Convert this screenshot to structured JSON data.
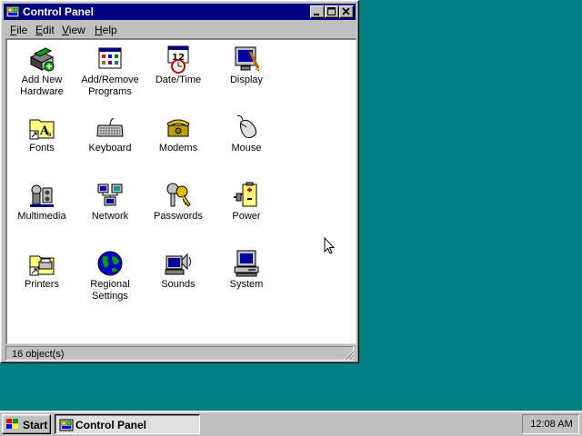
{
  "window": {
    "title": "Control Panel",
    "title_icon": "control-panel-icon",
    "controls": [
      "minimize",
      "maximize",
      "close"
    ]
  },
  "menu": [
    "File",
    "Edit",
    "View",
    "Help"
  ],
  "items": [
    {
      "label": "Add New\nHardware",
      "icon": "add-hardware-icon"
    },
    {
      "label": "Add/Remove\nPrograms",
      "icon": "add-remove-programs-icon"
    },
    {
      "label": "Date/Time",
      "icon": "date-time-icon"
    },
    {
      "label": "Display",
      "icon": "display-icon"
    },
    {
      "label": "Fonts",
      "icon": "fonts-icon"
    },
    {
      "label": "Keyboard",
      "icon": "keyboard-icon"
    },
    {
      "label": "Modems",
      "icon": "modems-icon"
    },
    {
      "label": "Mouse",
      "icon": "mouse-icon"
    },
    {
      "label": "Multimedia",
      "icon": "multimedia-icon"
    },
    {
      "label": "Network",
      "icon": "network-icon"
    },
    {
      "label": "Passwords",
      "icon": "passwords-icon"
    },
    {
      "label": "Power",
      "icon": "power-icon"
    },
    {
      "label": "Printers",
      "icon": "printers-icon"
    },
    {
      "label": "Regional\nSettings",
      "icon": "regional-settings-icon"
    },
    {
      "label": "Sounds",
      "icon": "sounds-icon"
    },
    {
      "label": "System",
      "icon": "system-icon"
    }
  ],
  "status": "16 object(s)",
  "taskbar": {
    "start_label": "Start",
    "task_label": "Control Panel",
    "clock": "12:08 AM"
  },
  "colors": {
    "desktop": "#008080",
    "titlebar": "#000080",
    "face": "#c0c0c0"
  }
}
